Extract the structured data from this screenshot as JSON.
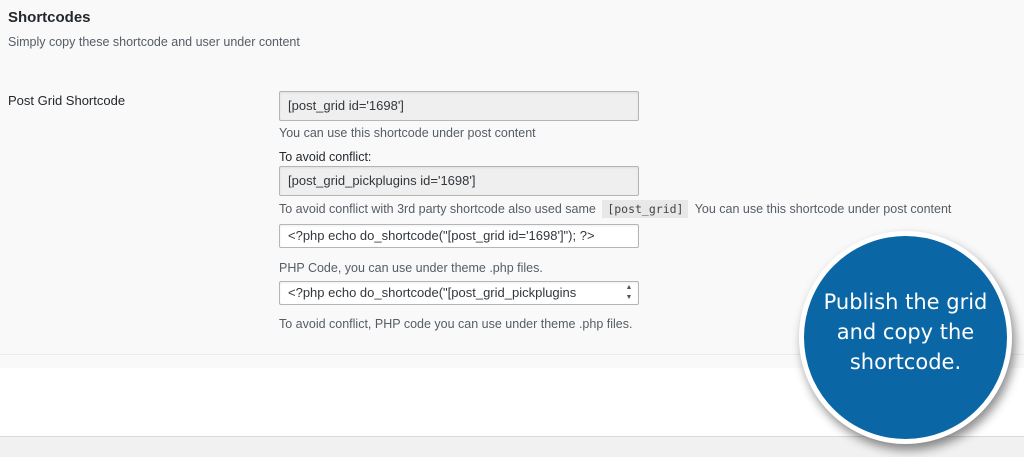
{
  "section": {
    "title": "Shortcodes",
    "subtitle": "Simply copy these shortcode and user under content"
  },
  "post_grid_shortcode": {
    "label": "Post Grid Shortcode",
    "shortcode_value": "[post_grid id='1698']",
    "shortcode_desc": "You can use this shortcode under post content",
    "avoid_conflict_label": "To avoid conflict:",
    "alt_shortcode_value": "[post_grid_pickplugins id='1698']",
    "alt_desc_before": "To avoid conflict with 3rd party shortcode also used same",
    "alt_desc_code": "[post_grid]",
    "alt_desc_after": "You can use this shortcode under post content",
    "php_code_value": "<?php echo do_shortcode(\"[post_grid id='1698']\"); ?>",
    "php_desc": "PHP Code, you can use under theme .php files.",
    "alt_php_code_value": "<?php echo do_shortcode(\"[post_grid_pickplugins",
    "alt_php_desc": "To avoid conflict, PHP code you can use under theme .php files."
  },
  "callout": {
    "text": "Publish the grid and copy the shortcode."
  }
}
